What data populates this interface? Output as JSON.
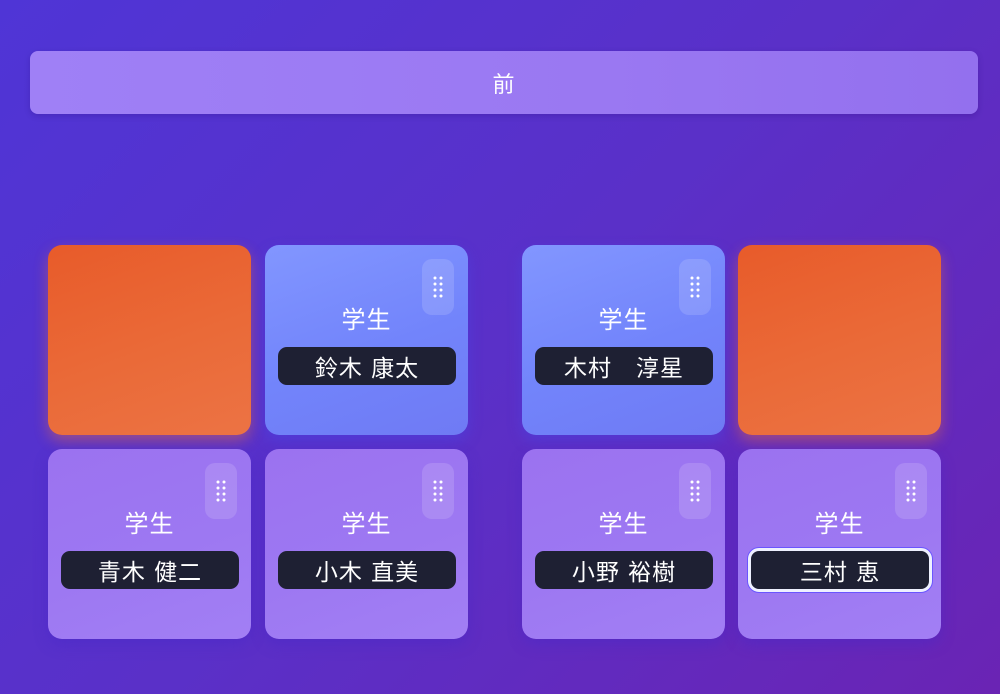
{
  "front_label": "前",
  "tiles": [
    {
      "role": "",
      "name": ""
    },
    {
      "role": "学生",
      "name": "鈴木 康太"
    },
    {
      "role": "学生",
      "name": "木村　淳星"
    },
    {
      "role": "",
      "name": ""
    },
    {
      "role": "学生",
      "name": "青木 健二"
    },
    {
      "role": "学生",
      "name": "小木 直美"
    },
    {
      "role": "学生",
      "name": "小野 裕樹"
    },
    {
      "role": "学生",
      "name": "三村 恵"
    }
  ],
  "icons": {
    "drag": "drag-handle-icon"
  },
  "colors": {
    "empty_seat": "#e85b2a",
    "front_row_seat": "#7284fb",
    "back_row_seat": "#9d78f2",
    "name_plate": "#1e2033"
  }
}
